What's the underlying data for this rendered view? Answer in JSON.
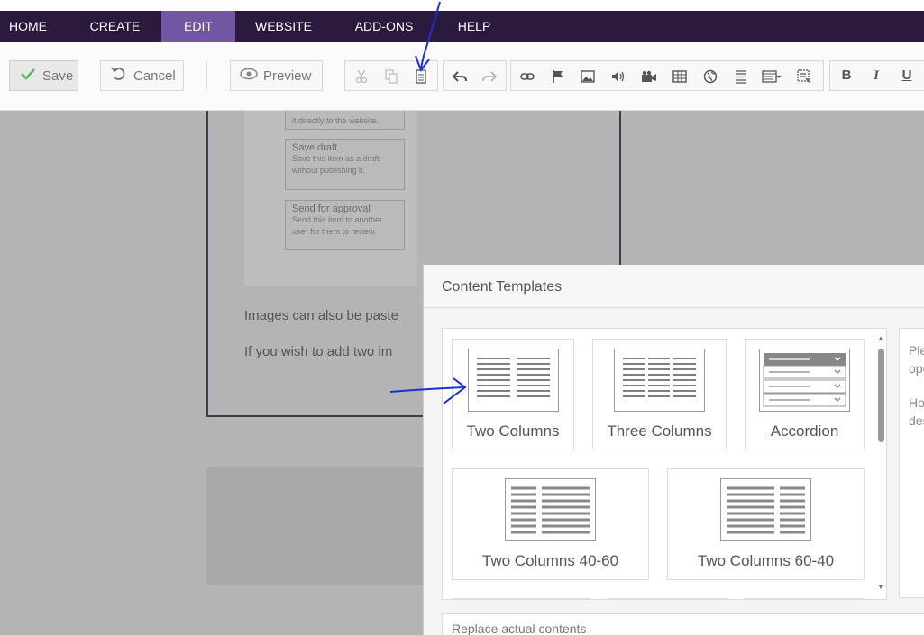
{
  "nav": {
    "tabs": [
      {
        "label": "HOME"
      },
      {
        "label": "CREATE"
      },
      {
        "label": "EDIT"
      },
      {
        "label": "WEBSITE"
      },
      {
        "label": "ADD-ONS"
      },
      {
        "label": "HELP"
      }
    ],
    "active_tab": "EDIT",
    "bg_color": "#2b1a3d",
    "active_color": "#7356a3"
  },
  "toolbar": {
    "save_label": "Save",
    "cancel_label": "Cancel",
    "preview_label": "Preview",
    "bold_label": "B",
    "italic_label": "I",
    "underline_label": "U"
  },
  "background": {
    "card_top_desc": "it directly to the website.",
    "cards": [
      {
        "title": "Save draft",
        "desc1": "Save this item as a draft",
        "desc2": "without publishing it."
      },
      {
        "title": "Send for approval",
        "desc1": "Send this item to another",
        "desc2": "user for them to review."
      }
    ],
    "line1": "Images can also be paste",
    "line2": "If you wish to add two im"
  },
  "dialog": {
    "title": "Content Templates",
    "templates": [
      {
        "label": "Two Columns"
      },
      {
        "label": "Three Columns"
      },
      {
        "label": "Accordion"
      },
      {
        "label": "Two Columns 40-60"
      },
      {
        "label": "Two Columns 60-40"
      }
    ],
    "desc_line1": "Ple",
    "desc_line2": "ope",
    "desc_line3": "Ho",
    "desc_line4": "des",
    "replace_label": "Replace actual contents"
  }
}
